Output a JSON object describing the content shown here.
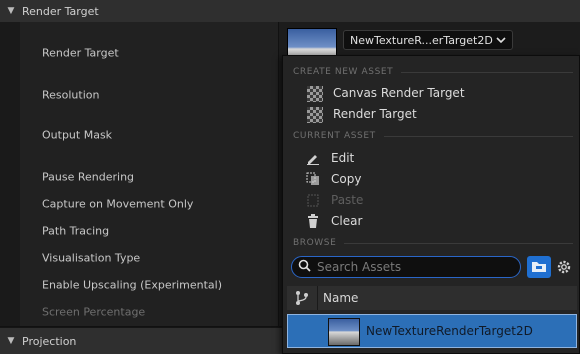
{
  "sections": {
    "render_target": "Render Target",
    "projection": "Projection"
  },
  "properties": [
    {
      "label": "Render Target"
    },
    {
      "label": "Resolution"
    },
    {
      "label": "Output Mask"
    },
    {
      "label": "Pause Rendering"
    },
    {
      "label": "Capture on Movement Only"
    },
    {
      "label": "Path Tracing"
    },
    {
      "label": "Visualisation Type"
    },
    {
      "label": "Enable Upscaling (Experimental)"
    },
    {
      "label": "Screen Percentage"
    }
  ],
  "asset_combo": {
    "value": "NewTextureR...erTarget2D"
  },
  "menu": {
    "create_heading": "CREATE NEW ASSET",
    "create_items": [
      "Canvas Render Target",
      "Render Target"
    ],
    "current_heading": "CURRENT ASSET",
    "current_items": [
      "Edit",
      "Copy",
      "Paste",
      "Clear"
    ],
    "browse_heading": "BROWSE",
    "search_placeholder": "Search Assets",
    "column_name": "Name",
    "selected_asset": "NewTextureRenderTarget2D"
  },
  "colors": {
    "accent": "#1f6fd1",
    "selection": "#2c6fb7"
  }
}
